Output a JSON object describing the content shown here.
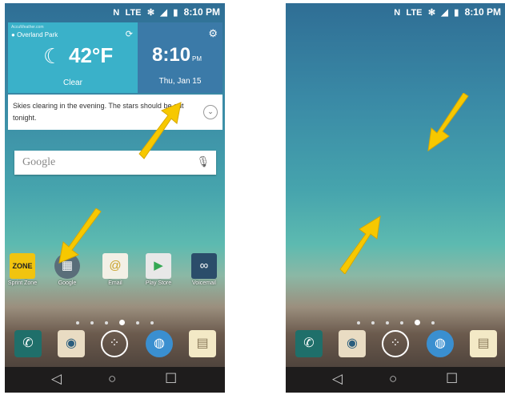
{
  "status": {
    "icons": [
      "N",
      "LTE",
      "✻",
      "◢",
      "▮"
    ],
    "time": "8:10 PM"
  },
  "weather": {
    "source": "AccuWeather.com",
    "location": "Overland Park",
    "temperature": "42°F",
    "condition": "Clear",
    "clock_time": "8:10",
    "clock_ampm": "PM",
    "date": "Thu, Jan 15"
  },
  "forecast": {
    "text": "Skies clearing in the evening. The stars should be out tonight."
  },
  "search": {
    "placeholder": "Google"
  },
  "apps": [
    {
      "label": "Sprint Zone"
    },
    {
      "label": "Google"
    },
    {
      "label": "Email"
    },
    {
      "label": "Play Store"
    },
    {
      "label": "Voicemail"
    }
  ],
  "colors": {
    "arrow": "#f7c800",
    "accent": "#3ab1c9"
  }
}
